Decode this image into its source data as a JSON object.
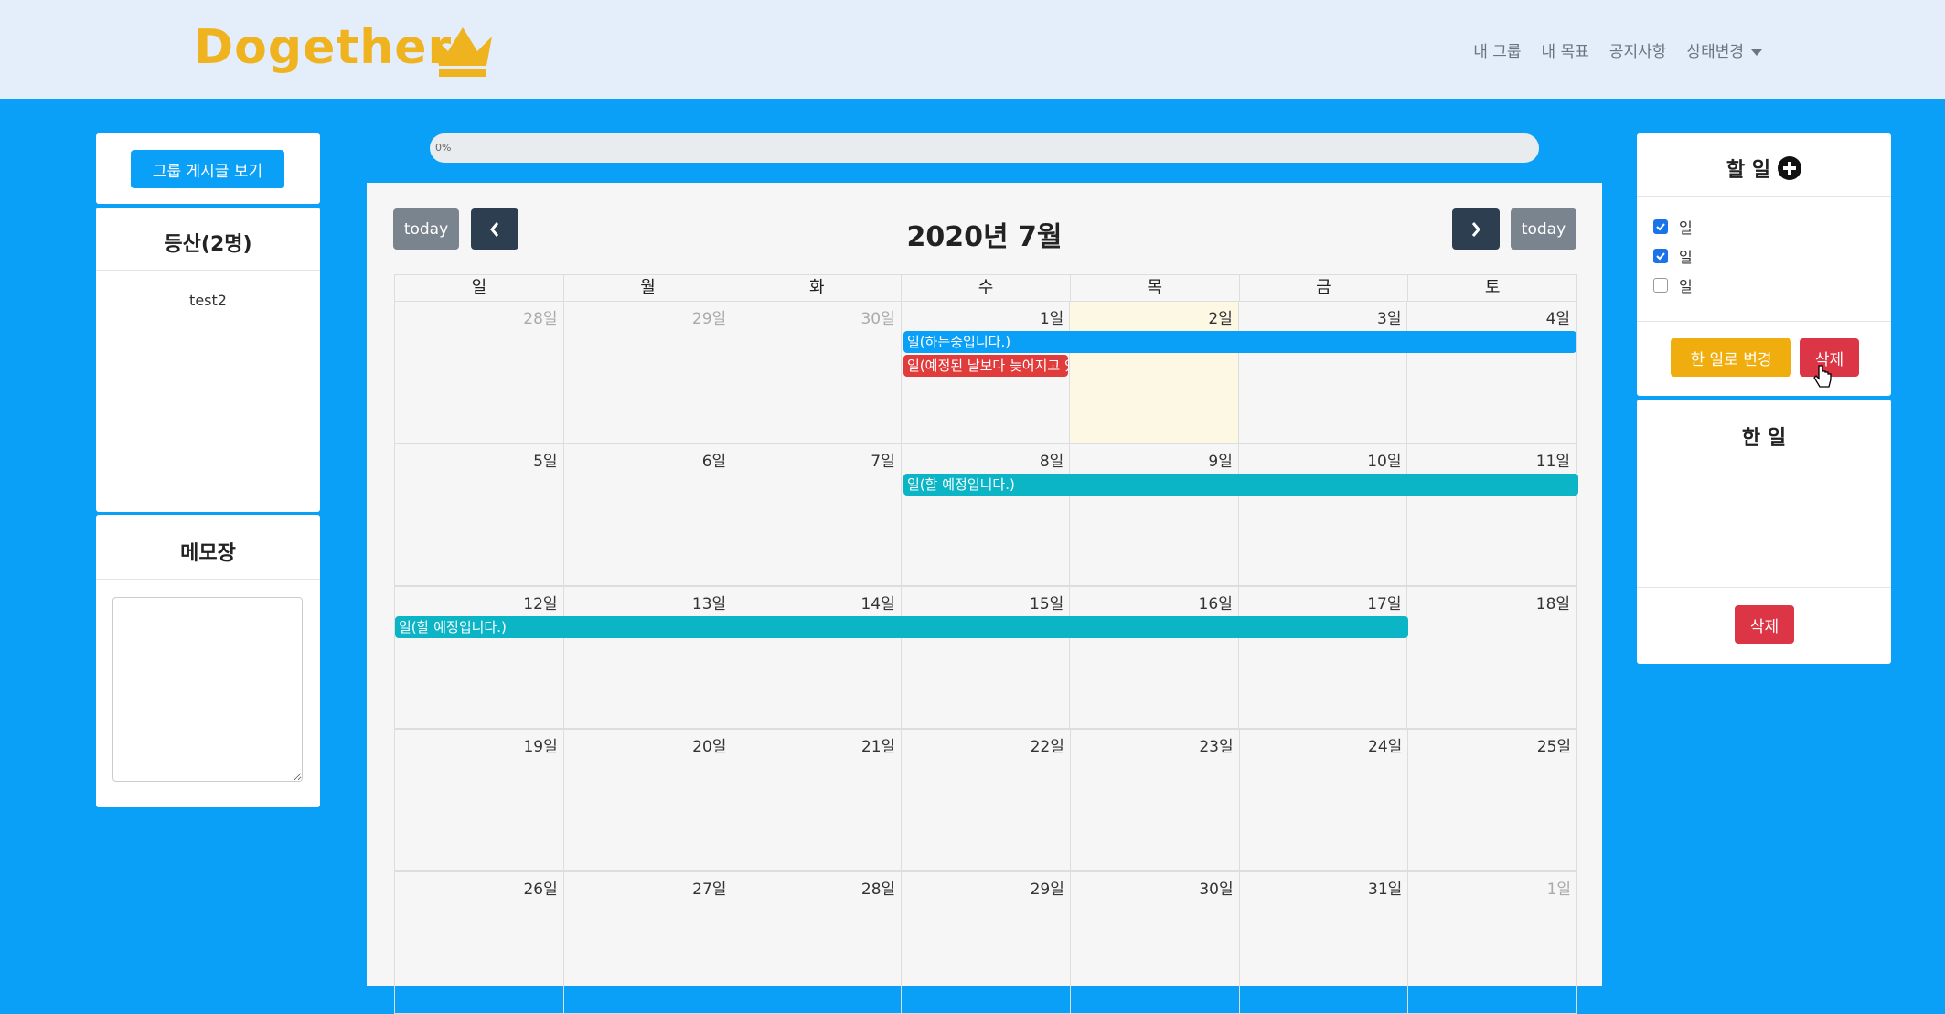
{
  "brand": "Dogether",
  "nav": {
    "items": [
      "내 그룹",
      "내 목표",
      "공지사항"
    ],
    "status": "상태변경"
  },
  "left": {
    "group_posts_button": "그룹 게시글 보기",
    "group_title": "등산(2명)",
    "members": [
      "test2"
    ],
    "memo_title": "메모장",
    "memo_value": ""
  },
  "progress": {
    "label": "0%",
    "value": 0
  },
  "calendar": {
    "title": "2020년 7월",
    "today_label": "today",
    "dow": [
      "일",
      "월",
      "화",
      "수",
      "목",
      "금",
      "토"
    ],
    "weeks": [
      [
        "28일",
        "29일",
        "30일",
        "1일",
        "2일",
        "3일",
        "4일"
      ],
      [
        "5일",
        "6일",
        "7일",
        "8일",
        "9일",
        "10일",
        "11일"
      ],
      [
        "12일",
        "13일",
        "14일",
        "15일",
        "16일",
        "17일",
        "18일"
      ],
      [
        "19일",
        "20일",
        "21일",
        "22일",
        "23일",
        "24일",
        "25일"
      ],
      [
        "26일",
        "27일",
        "28일",
        "29일",
        "30일",
        "31일",
        "1일"
      ]
    ],
    "events": [
      {
        "title": "일(하는중입니다.)",
        "color": "#0aa0f7"
      },
      {
        "title": "일(예정된 날보다 늦어지고 있습니다.)",
        "color": "#e03c3c"
      },
      {
        "title": "일(할 예정입니다.)",
        "color": "#0bb5c6"
      },
      {
        "title": "일(할 예정입니다.)",
        "color": "#0bb5c6"
      }
    ]
  },
  "right": {
    "todo_title": "할 일",
    "todo_items": [
      {
        "label": "일",
        "checked": true
      },
      {
        "label": "일",
        "checked": true
      },
      {
        "label": "일",
        "checked": false
      }
    ],
    "move_done_button": "한 일로 변경",
    "delete_button": "삭제",
    "done_title": "한 일",
    "done_delete_button": "삭제"
  },
  "colors": {
    "background": "#0aa0f7",
    "navbar": "#e3eefa",
    "brand": "#efb320",
    "dark_button": "#2c3e50",
    "danger": "#dc3545",
    "warning": "#f0ad0e"
  }
}
